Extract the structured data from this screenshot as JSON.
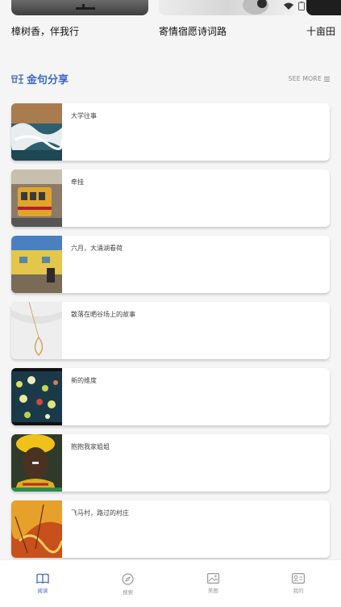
{
  "carousel": {
    "items": [
      {
        "title": "樟树香，伴我行"
      },
      {
        "title": "寄情宿愿诗词路"
      },
      {
        "title": "十亩田"
      }
    ]
  },
  "section": {
    "title": "金句分享",
    "see_more": "SEE MORE"
  },
  "cards": [
    {
      "title": "大学往事"
    },
    {
      "title": "牵挂"
    },
    {
      "title": "六月，大涌湖看荷"
    },
    {
      "title": "散落在晒谷场上的故事"
    },
    {
      "title": "新的维度"
    },
    {
      "title": "抱抱我家姐姐"
    },
    {
      "title": "飞马村，路过的村庄"
    }
  ],
  "nav": {
    "items": [
      {
        "label": "阅读",
        "icon": "book-icon",
        "active": true
      },
      {
        "label": "搜索",
        "icon": "compass-icon",
        "active": false
      },
      {
        "label": "美图",
        "icon": "image-icon",
        "active": false
      },
      {
        "label": "我的",
        "icon": "profile-card-icon",
        "active": false
      }
    ]
  },
  "colors": {
    "accent": "#3a69c6",
    "background": "#f5f5f5"
  }
}
